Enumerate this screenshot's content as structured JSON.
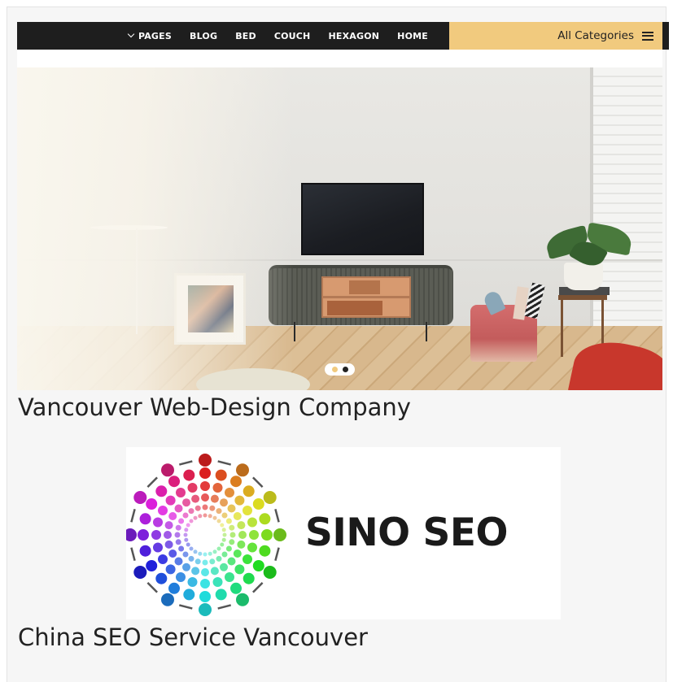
{
  "nav": {
    "items": [
      {
        "label": "PAGES",
        "has_dropdown": true
      },
      {
        "label": "BLOG"
      },
      {
        "label": "BED"
      },
      {
        "label": "COUCH"
      },
      {
        "label": "HEXAGON"
      },
      {
        "label": "HOME"
      }
    ],
    "categories_label": "All Categories",
    "colors": {
      "nav_bg": "#1e1e1e",
      "accent": "#f1ca7e",
      "nav_text": "#ffffff"
    }
  },
  "hero": {
    "image": "living-room-tv-console",
    "slides_count": 2,
    "active_slide": 2
  },
  "articles": [
    {
      "title": "Vancouver Web-Design Company"
    },
    {
      "title": "China SEO Service Vancouver",
      "logo_text": "SINO SEO",
      "logo_icon": "radial-dot-circle-logo"
    }
  ]
}
